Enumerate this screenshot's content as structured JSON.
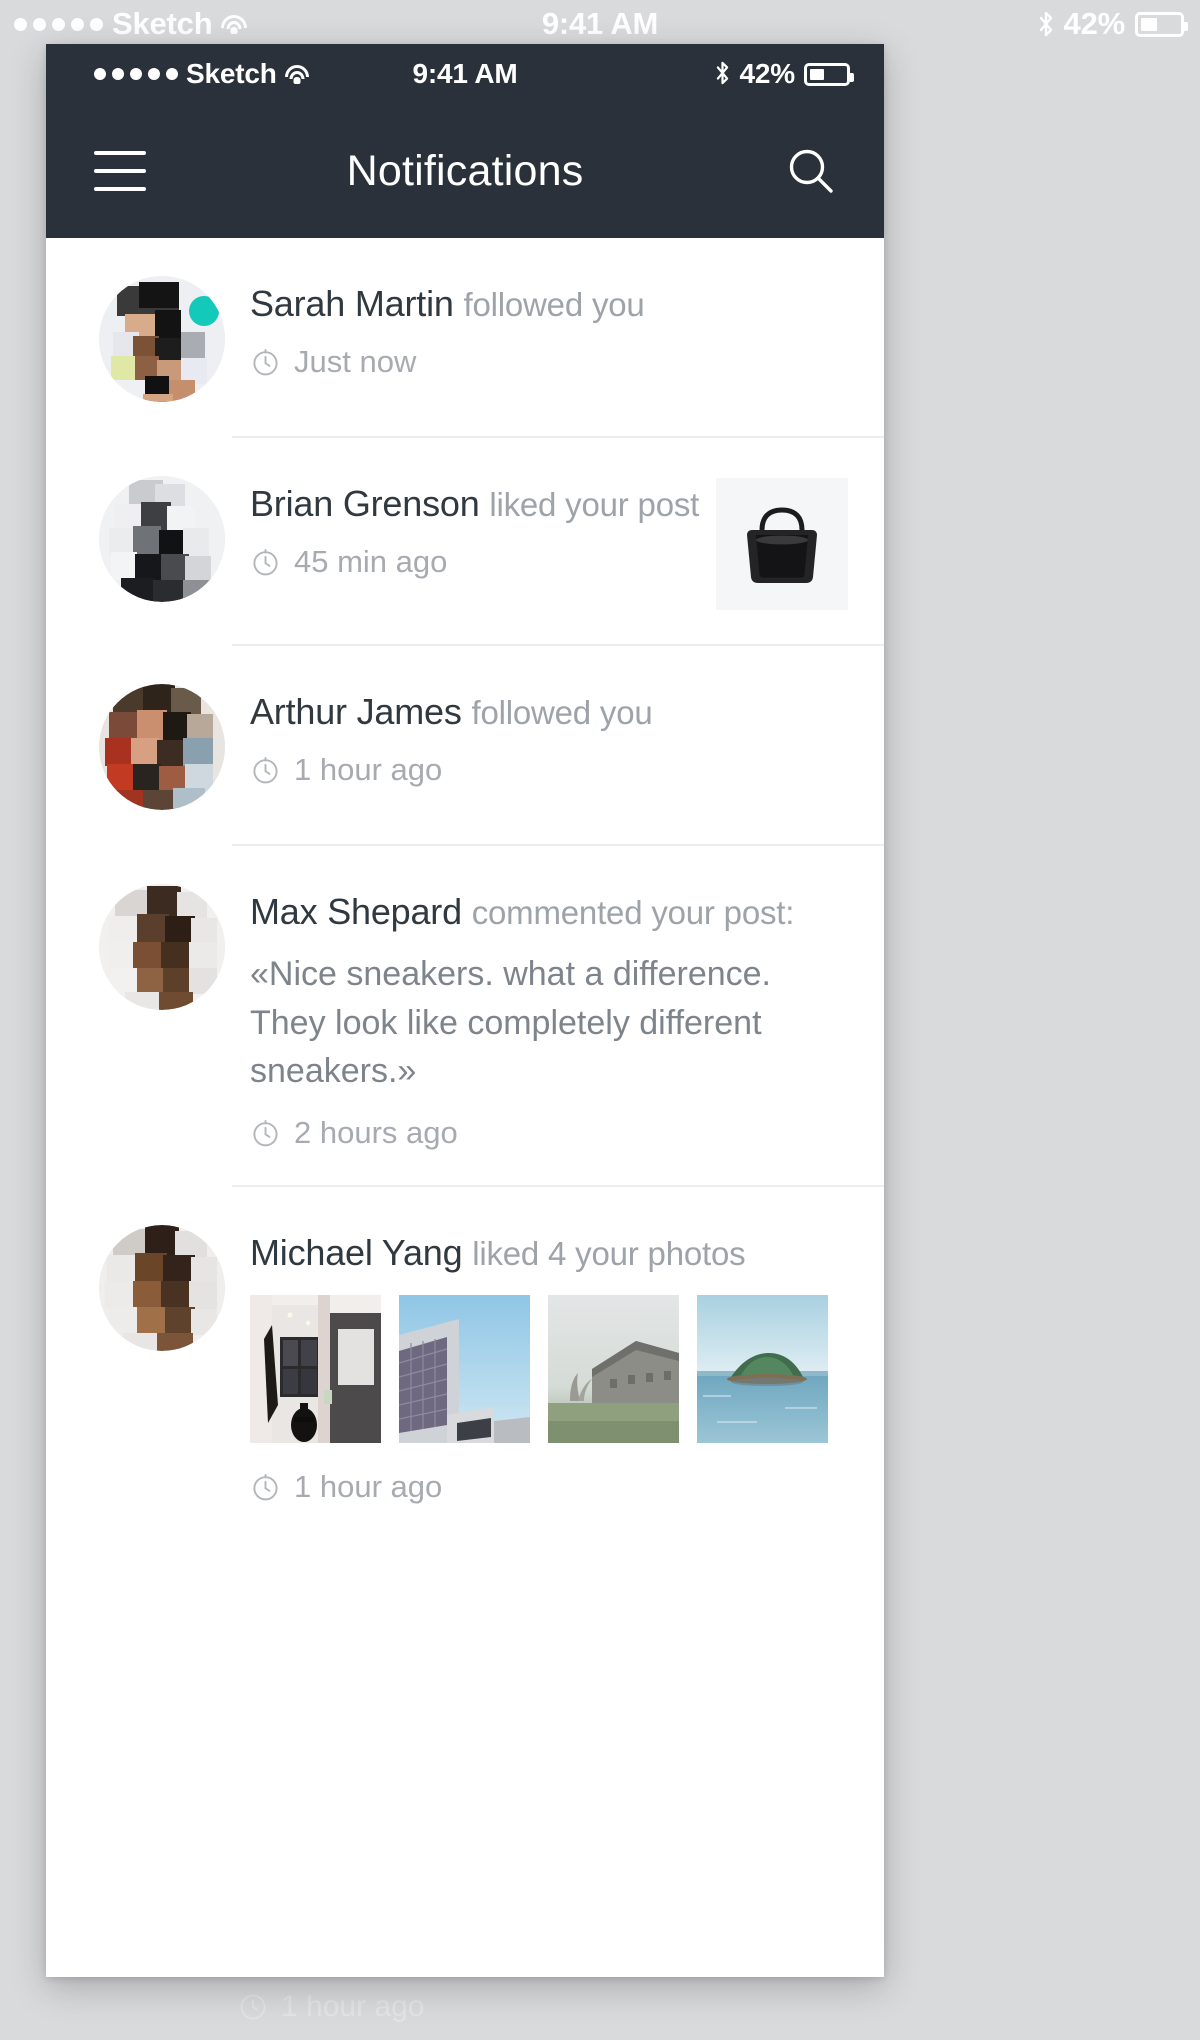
{
  "background_statusbar": {
    "carrier": "Sketch",
    "time": "9:41 AM",
    "battery_percent": "42%",
    "signal_dots": 5,
    "icons": [
      "wifi-icon",
      "bluetooth-icon",
      "battery-icon"
    ]
  },
  "ghost_text": "1 hour ago",
  "phone": {
    "statusbar": {
      "carrier": "Sketch",
      "time": "9:41 AM",
      "battery_percent": "42%",
      "signal_dots": 5,
      "icons": [
        "wifi-icon",
        "bluetooth-icon",
        "battery-icon"
      ]
    },
    "navbar": {
      "title": "Notifications",
      "menu_icon": "hamburger-icon",
      "search_icon": "search-icon",
      "background_color": "#2b313a",
      "text_color": "#ffffff"
    }
  },
  "colors": {
    "nav_dark": "#2b313a",
    "name_text": "#303840",
    "action_text": "#9ea3a9",
    "time_text": "#a7abb0",
    "comment_text": "#7e848b",
    "online_badge": "#13c9ba",
    "divider": "#eceded",
    "page_background": "#d9dadc"
  },
  "notifications": [
    {
      "name": "Sarah Martin",
      "action": "followed you",
      "time": "Just now",
      "clock_icon": "clock-icon",
      "avatar": "avatar-sarah-martin",
      "online": true,
      "comment": null,
      "thumbnail": null,
      "photos": []
    },
    {
      "name": "Brian Grenson",
      "action": "liked your post",
      "time": "45 min ago",
      "clock_icon": "clock-icon",
      "avatar": "avatar-brian-grenson",
      "online": false,
      "comment": null,
      "thumbnail": "thumbnail-black-handbag",
      "photos": []
    },
    {
      "name": "Arthur James",
      "action": "followed you",
      "time": "1 hour ago",
      "clock_icon": "clock-icon",
      "avatar": "avatar-arthur-james",
      "online": false,
      "comment": null,
      "thumbnail": null,
      "photos": []
    },
    {
      "name": "Max Shepard",
      "action": "commented your post:",
      "time": "2 hours ago",
      "clock_icon": "clock-icon",
      "avatar": "avatar-max-shepard",
      "online": false,
      "comment": "«Nice sneakers. what a difference. They look like completely different sneakers.»",
      "thumbnail": null,
      "photos": []
    },
    {
      "name": "Michael Yang",
      "action": "liked 4 your photos",
      "time": "1 hour ago",
      "clock_icon": "clock-icon",
      "avatar": "avatar-michael-yang",
      "online": false,
      "comment": null,
      "thumbnail": null,
      "photos": [
        "photo-interior-room",
        "photo-modern-building",
        "photo-foggy-barn",
        "photo-island-sea"
      ]
    }
  ]
}
